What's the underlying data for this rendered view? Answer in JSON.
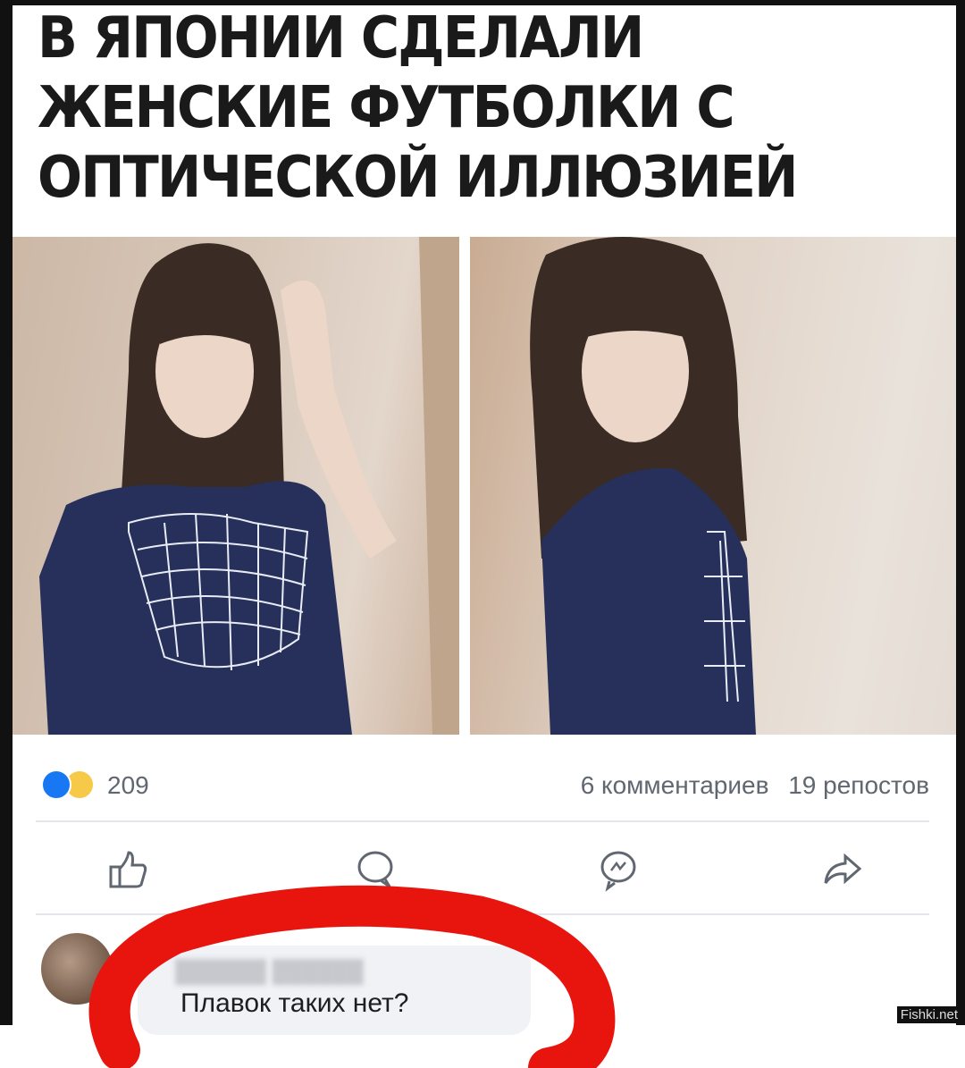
{
  "post": {
    "headline": "В ЯПОНИИ СДЕЛАЛИ ЖЕНСКИЕ ФУТБОЛКИ С ОПТИЧЕСКОЙ ИЛЛЮЗИЕЙ",
    "reactions": {
      "icons": [
        "like-icon",
        "haha-icon"
      ],
      "count": "209"
    },
    "comments_count": "6 комментариев",
    "reposts_count": "19 репостов",
    "actions": [
      "like-icon",
      "comment-icon",
      "messenger-icon",
      "share-icon"
    ]
  },
  "comment": {
    "text": "Плавок таких нет?"
  },
  "watermark": "Fishki.net",
  "colors": {
    "like_blue": "#1877f2",
    "highlight_red": "#e8140e",
    "shirt_navy": "#26305a"
  }
}
